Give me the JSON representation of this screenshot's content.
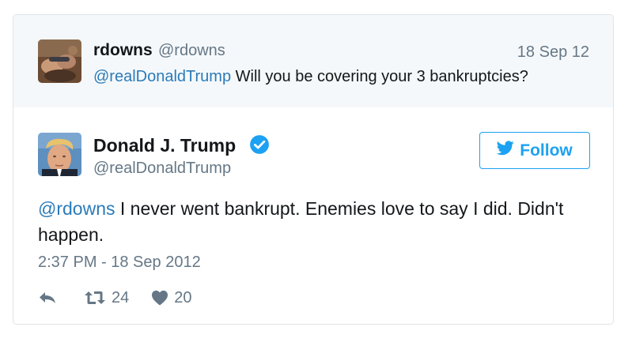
{
  "reply_context": {
    "name": "rdowns",
    "handle": "@rdowns",
    "date": "18 Sep 12",
    "mention": "@realDonaldTrump",
    "text": " Will you be covering your 3 bankruptcies?"
  },
  "tweet": {
    "name": "Donald J. Trump",
    "handle": "@realDonaldTrump",
    "verified_icon": "verified-badge-icon",
    "mention": "@rdowns",
    "text": " I never went bankrupt. Enemies love to say I did. Didn't happen.",
    "timestamp": "2:37 PM - 18 Sep 2012",
    "retweet_count": "24",
    "like_count": "20"
  },
  "follow_button": {
    "label": "Follow",
    "icon": "twitter-bird-icon"
  },
  "icons": {
    "reply": "reply-icon",
    "retweet": "retweet-icon",
    "like": "heart-icon"
  },
  "colors": {
    "link": "#2b7bb9",
    "brand": "#1da1f2",
    "muted": "#657786",
    "context_bg": "#f5f8fa",
    "border": "#dfe3e8"
  }
}
